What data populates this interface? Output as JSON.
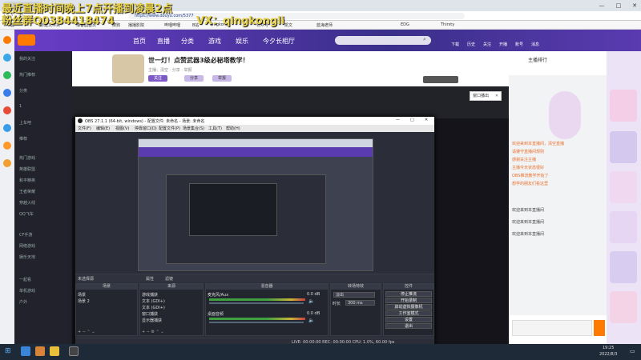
{
  "browser": {
    "tab_label": "",
    "url": "https://www.douyu.com/5377",
    "bookmarks": [
      "书签",
      "新建文件夹",
      "博客园首页",
      "搜狗",
      "播播影院",
      "哔哩哔哩",
      "B站",
      "qingkong",
      "公众号",
      "凯文",
      "蓝海老师",
      "EDG",
      "Thirsty"
    ]
  },
  "overlay": {
    "line1": "最近直播时间晚上7点开播到凌晨2点",
    "line2": "粉丝群Q0384418474",
    "line3": "VX：qingkongli"
  },
  "douyu_nav": {
    "items": [
      "首页",
      "直播",
      "分类",
      "游戏",
      "娱乐",
      "今夕长相厅"
    ],
    "right_items": [
      "下载",
      "历史",
      "关注",
      "开播",
      "账号",
      "消息"
    ]
  },
  "sidebar": {
    "items": [
      "我的关注",
      "热门推荐",
      "分类",
      "1",
      "上车吧",
      "推荐",
      "热门游戏",
      "英雄联盟",
      "和平精英",
      "王者荣耀",
      "穿越火线",
      "QQ飞车",
      "CF手游",
      "网络游戏",
      "娱乐天地",
      "一起看",
      "单机游戏",
      "户外"
    ]
  },
  "stream": {
    "title": "世一灯！点赞武器3级必秘塔教学！",
    "subtitle": "主播：清空 · 分享 · 举报",
    "btn_follow": "关注",
    "btn_share": "分享",
    "btn_report": "举报",
    "popup": "窗口播出"
  },
  "right_panel": {
    "header": "主播排行",
    "chat": [
      "欢迎来到本直播间，清空直播",
      "请遵守直播间规则",
      "感谢关注主播",
      "主播今天状态很好",
      "OBS推流教学开始了",
      "想学的朋友们看这里",
      "欢迎来到本直播间",
      "欢迎来到本直播间",
      "欢迎来到本直播间"
    ]
  },
  "obs": {
    "title": "OBS 27.1.1 (64-bit, windows) - 配置文件: 未命名 - 场景: 未命名",
    "menu": [
      "文件(F)",
      "编辑(E)",
      "视图(V)",
      "停靠窗口(D)",
      "配置文件(P)",
      "场景集合(S)",
      "工具(T)",
      "帮助(H)"
    ],
    "no_source": "未选择源",
    "scene_prop_btn": "属性",
    "scene_filter_btn": "滤镜",
    "docks": {
      "scenes": {
        "header": "场景",
        "items": [
          "场景",
          "场景 2"
        ]
      },
      "sources": {
        "header": "来源",
        "items": [
          "游戏捕获",
          "文本 (GDI+)",
          "文本 (GDI+)",
          "窗口捕获",
          "显示器捕获"
        ]
      },
      "mixer": {
        "header": "混音器",
        "ch1": "麦克风/Aux",
        "ch1_val": "0.0 dB",
        "ch2": "桌面音频",
        "ch2_val": "0.0 dB"
      },
      "transition": {
        "header": "转场特效",
        "type": "淡出",
        "duration_label": "时长",
        "duration": "300 ms"
      },
      "controls": {
        "header": "控件",
        "buttons": [
          "停止推流",
          "开始录制",
          "启动虚拟摄像机",
          "工作室模式",
          "设置",
          "退出"
        ]
      }
    },
    "status": "LIVE: 00:00:00  REC: 00:00:00  CPU: 1.0%, 60.00 fps"
  },
  "taskbar": {
    "time": "19:25",
    "date": "2022/8/3"
  },
  "colors": {
    "brand": "#ff7a00",
    "douyu_purple": "#5a3bb0",
    "obs_bg": "#2b2e38"
  }
}
